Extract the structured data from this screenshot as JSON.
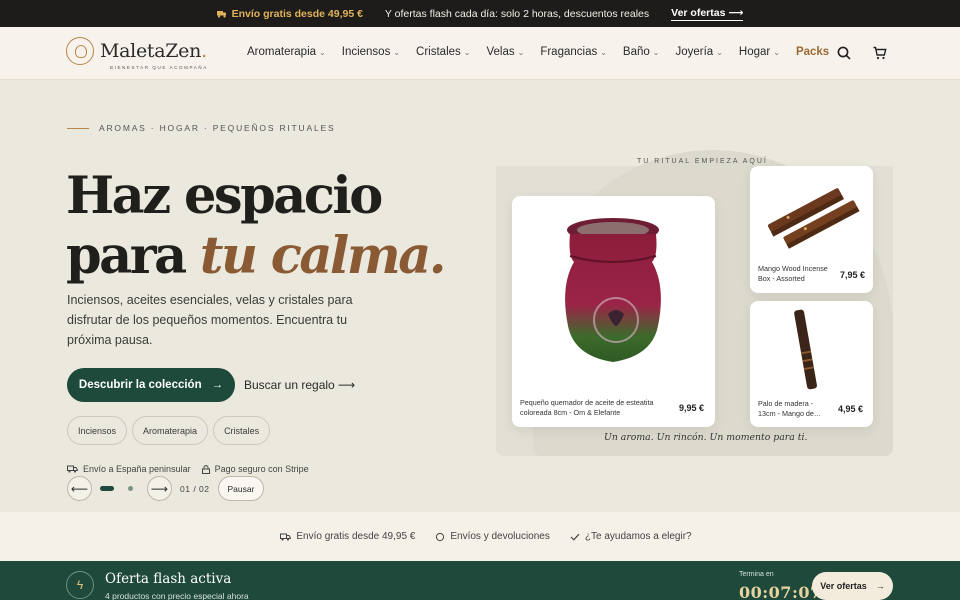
{
  "announcement": {
    "free_shipping": "Envío gratis desde 49,95 €",
    "flash_text": "Y ofertas flash cada día: solo 2 horas, descuentos reales",
    "cta": "Ver ofertas ⟶"
  },
  "header": {
    "logo_text": "MaletaZen",
    "logo_dot": ".",
    "logo_tagline": "BIENESTAR QUE ACOMPAÑA",
    "nav": [
      {
        "label": "Aromaterapia",
        "has_dropdown": true
      },
      {
        "label": "Inciensos",
        "has_dropdown": true
      },
      {
        "label": "Cristales",
        "has_dropdown": true
      },
      {
        "label": "Velas",
        "has_dropdown": true
      },
      {
        "label": "Fragancias",
        "has_dropdown": true
      },
      {
        "label": "Baño",
        "has_dropdown": true
      },
      {
        "label": "Joyería",
        "has_dropdown": true
      },
      {
        "label": "Hogar",
        "has_dropdown": true
      },
      {
        "label": "Packs",
        "has_dropdown": false
      }
    ],
    "icons": [
      "search-icon",
      "cart-icon"
    ]
  },
  "hero": {
    "eyebrow": "AROMAS · HOGAR · PEQUEÑOS RITUALES",
    "title_line1": "Haz espacio",
    "title_line2_plain": "para ",
    "title_line2_accent": "tu calma.",
    "lead": "Inciensos, aceites esenciales, velas y cristales para disfrutar de los pequeños momentos. Encuentra tu próxima pausa.",
    "cta_primary": "Descubrir la colección",
    "cta_secondary": "Buscar un regalo ⟶",
    "chips": [
      "Inciensos",
      "Aromaterapia",
      "Cristales"
    ],
    "trust": [
      "Envío a España peninsular",
      "Pago seguro con Stripe"
    ],
    "carousel": {
      "counter": "01 / 02",
      "pause_label": "Pausar",
      "active_slide": 1,
      "total_slides": 2
    }
  },
  "showcase": {
    "kicker": "TU RITUAL EMPIEZA AQUÍ",
    "caption": "Un aroma. Un rincón. Un momento para ti.",
    "products": [
      {
        "name": "Pequeño quemador de aceite de esteatita coloreada 8cm - Om & Elefante",
        "price": "9,95 €"
      },
      {
        "name": "Mango Wood Incense Box - Assorted",
        "price": "7,95 €"
      },
      {
        "name": "Palo de madera - 13cm - Mango de…",
        "price": "4,95 €"
      }
    ]
  },
  "strip": {
    "items": [
      "Envío gratis desde 49,95 €",
      "Envíos y devoluciones",
      "¿Te ayudamos a elegir?"
    ]
  },
  "flash": {
    "title": "Oferta flash activa",
    "subtitle": "4 productos con precio especial ahora",
    "ends_label": "Termina en",
    "timer": "00:07:07",
    "cta": "Ver ofertas"
  },
  "colors": {
    "brand_green": "#1e4a3b",
    "accent_brown": "#8a5a35",
    "gold": "#e0b35a",
    "background": "#ebe8dd"
  }
}
